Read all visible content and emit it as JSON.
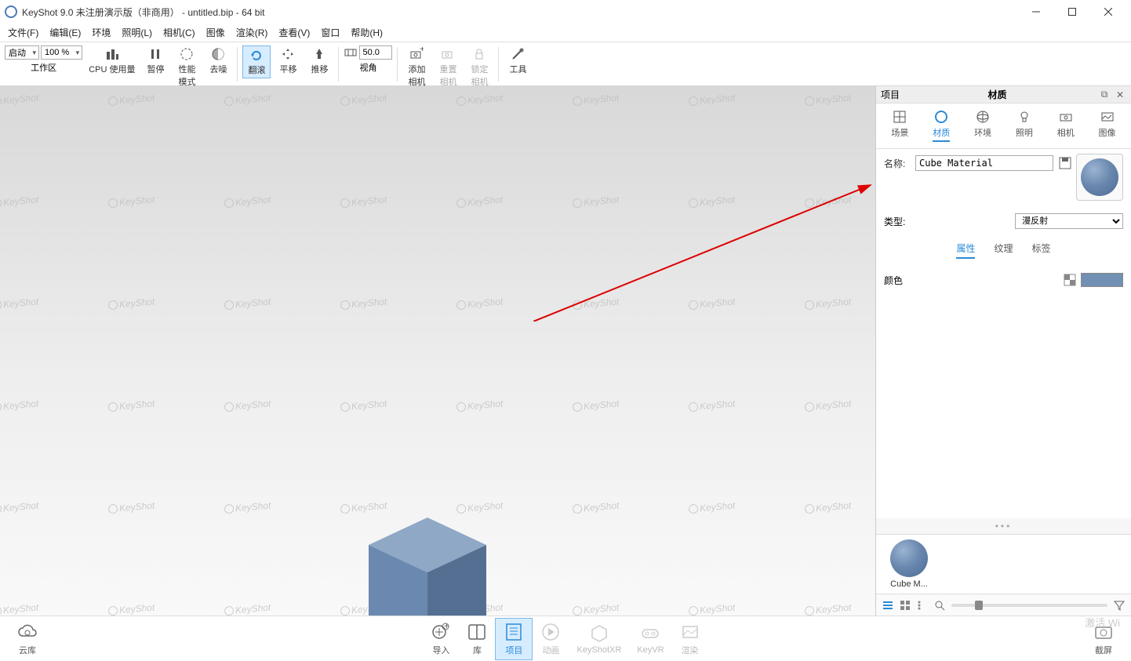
{
  "titlebar": {
    "title": "KeyShot 9.0 未注册演示版（非商用） - untitled.bip  - 64 bit"
  },
  "menu": {
    "file": "文件(F)",
    "edit": "编辑(E)",
    "env": "环境",
    "light": "照明(L)",
    "camera": "相机(C)",
    "image": "图像",
    "render": "渲染(R)",
    "view": "查看(V)",
    "window": "窗口",
    "help": "帮助(H)"
  },
  "toolbar": {
    "startup": "启动",
    "zoom": "100 %",
    "workspace": "工作区",
    "cpu": "CPU 使用量",
    "pause": "暂停",
    "perf": "性能\n模式",
    "denoise": "去噪",
    "tumble": "翻滚",
    "pan": "平移",
    "dolly": "推移",
    "fov_label": "视角",
    "fov_value": "50.0",
    "addcam": "添加\n相机",
    "resetcam": "重置\n相机",
    "lockcam": "锁定\n相机",
    "tools": "工具"
  },
  "panel": {
    "project": "项目",
    "header": "材质",
    "tabs": {
      "scene": "场景",
      "material": "材质",
      "env": "环境",
      "light": "照明",
      "camera": "相机",
      "image": "图像"
    },
    "name_label": "名称:",
    "name_value": "Cube Material",
    "type_label": "类型:",
    "type_value": "漫反射",
    "subtabs": {
      "props": "属性",
      "texture": "纹理",
      "label": "标签"
    },
    "color_label": "颜色",
    "thumb_name": "Cube M..."
  },
  "bottombar": {
    "cloud": "云库",
    "import": "导入",
    "library": "库",
    "project": "项目",
    "anim": "动画",
    "xr": "KeyShotXR",
    "vr": "KeyVR",
    "render": "渲染",
    "screenshot": "截屏"
  },
  "activation": "激活 Wi",
  "watermark": "KeyShot"
}
